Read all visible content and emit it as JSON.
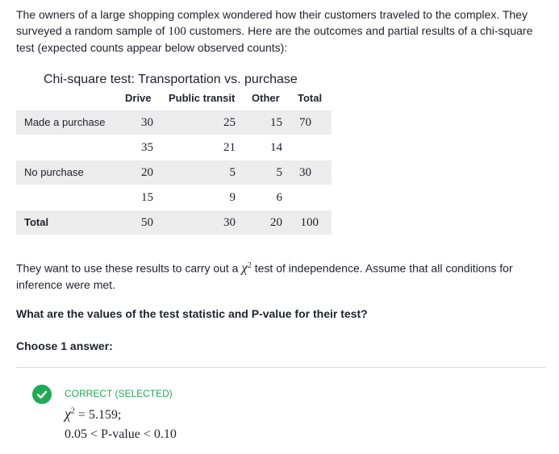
{
  "intro": {
    "line1": "The owners of a large shopping complex wondered how their customers traveled to the complex. They",
    "line2a": "surveyed a random sample of",
    "sample_size": "100",
    "line2b": "customers. Here are the outcomes and partial results of a chi-square",
    "line3": "test (expected counts appear below observed counts):"
  },
  "table": {
    "title": "Chi-square test: Transportation vs. purchase",
    "headers": [
      "Drive",
      "Public transit",
      "Other",
      "Total"
    ],
    "rows": [
      {
        "label": "Made a purchase",
        "values": [
          "30",
          "25",
          "15",
          "70"
        ]
      },
      {
        "label": "",
        "values": [
          "35",
          "21",
          "14",
          ""
        ]
      },
      {
        "label": "No purchase",
        "values": [
          "20",
          "5",
          "5",
          "30"
        ]
      },
      {
        "label": "",
        "values": [
          "15",
          "9",
          "6",
          ""
        ]
      },
      {
        "label": "Total",
        "values": [
          "50",
          "30",
          "20",
          "100"
        ]
      }
    ]
  },
  "para2": {
    "before": "They want to use these results to carry out a",
    "chi": "χ",
    "sup": "2",
    "after": "test of independence. Assume that all conditions for",
    "line2": "inference were met."
  },
  "question": "What are the values of the test statistic and P-value for their test?",
  "choose_label": "Choose 1 answer:",
  "answer": {
    "status": "CORRECT (SELECTED)",
    "chi": "χ",
    "sup": "2",
    "stat": "= 5.159;",
    "pvalue": "0.05 < P-value < 0.10"
  },
  "colors": {
    "correct_green": "#1fab54",
    "row_shade": "#ececec",
    "text": "#21242c"
  },
  "icons": {
    "check": "check-circle-icon"
  }
}
